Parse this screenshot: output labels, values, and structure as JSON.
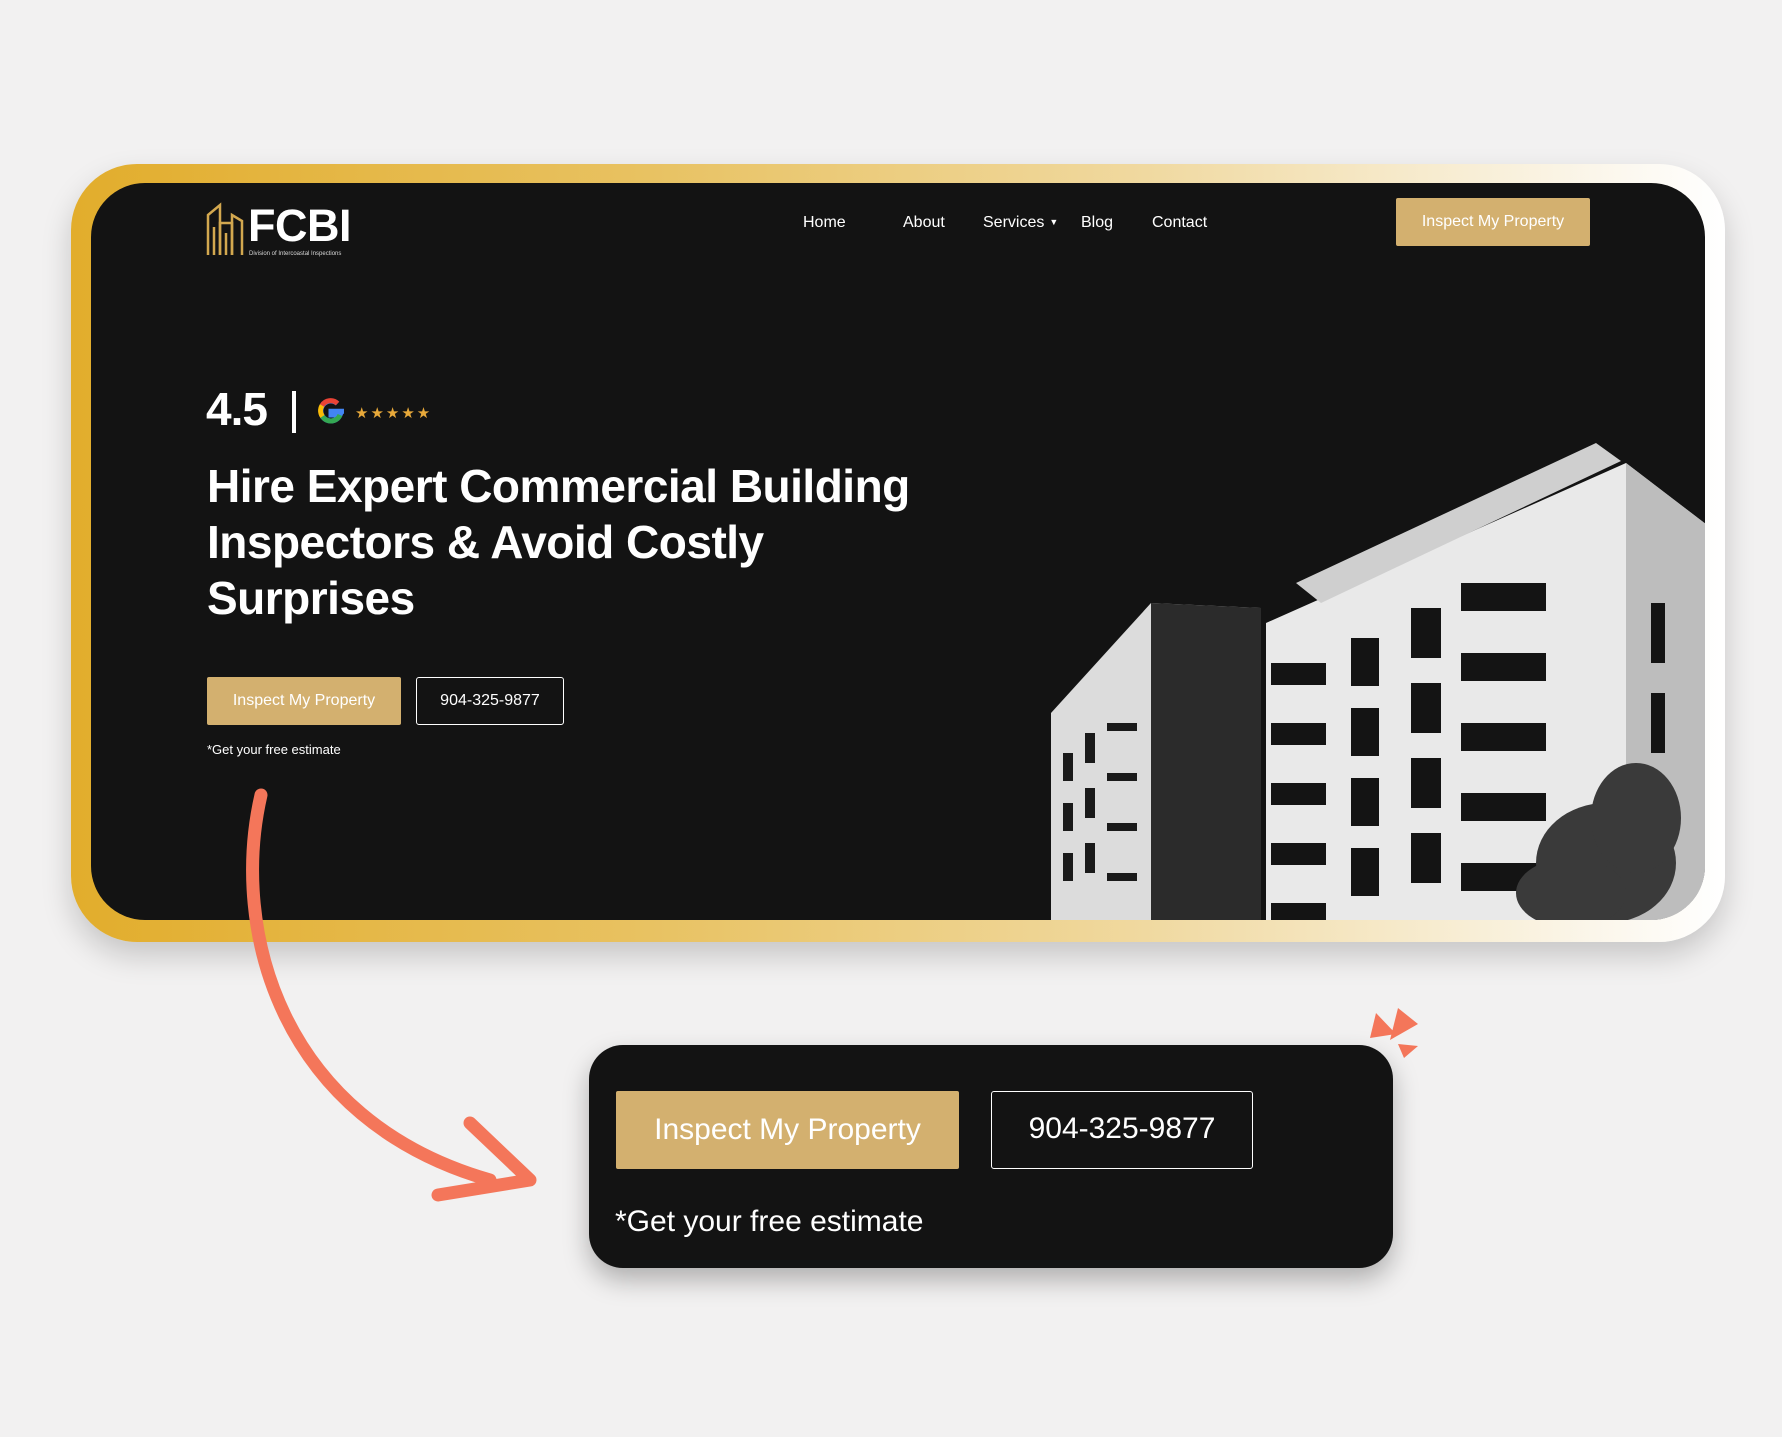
{
  "brand": {
    "name": "FCBI",
    "tagline": "Division of Intercoastal Inspections"
  },
  "nav": {
    "items": [
      "Home",
      "About",
      "Services",
      "Blog",
      "Contact"
    ],
    "cta_label": "Inspect My Property"
  },
  "hero": {
    "rating_value": "4.5",
    "rating_stars": "★★★★★",
    "headline": "Hire Expert Commercial Building Inspectors & Avoid Costly Surprises",
    "primary_cta": "Inspect My Property",
    "phone": "904-325-9877",
    "note": "*Get your free estimate"
  },
  "zoom": {
    "primary_cta": "Inspect My Property",
    "phone": "904-325-9877",
    "note": "*Get your free estimate"
  },
  "colors": {
    "gold": "#d3b06f",
    "dark": "#131313",
    "arrow": "#f4765a",
    "star": "#e8a93a"
  }
}
